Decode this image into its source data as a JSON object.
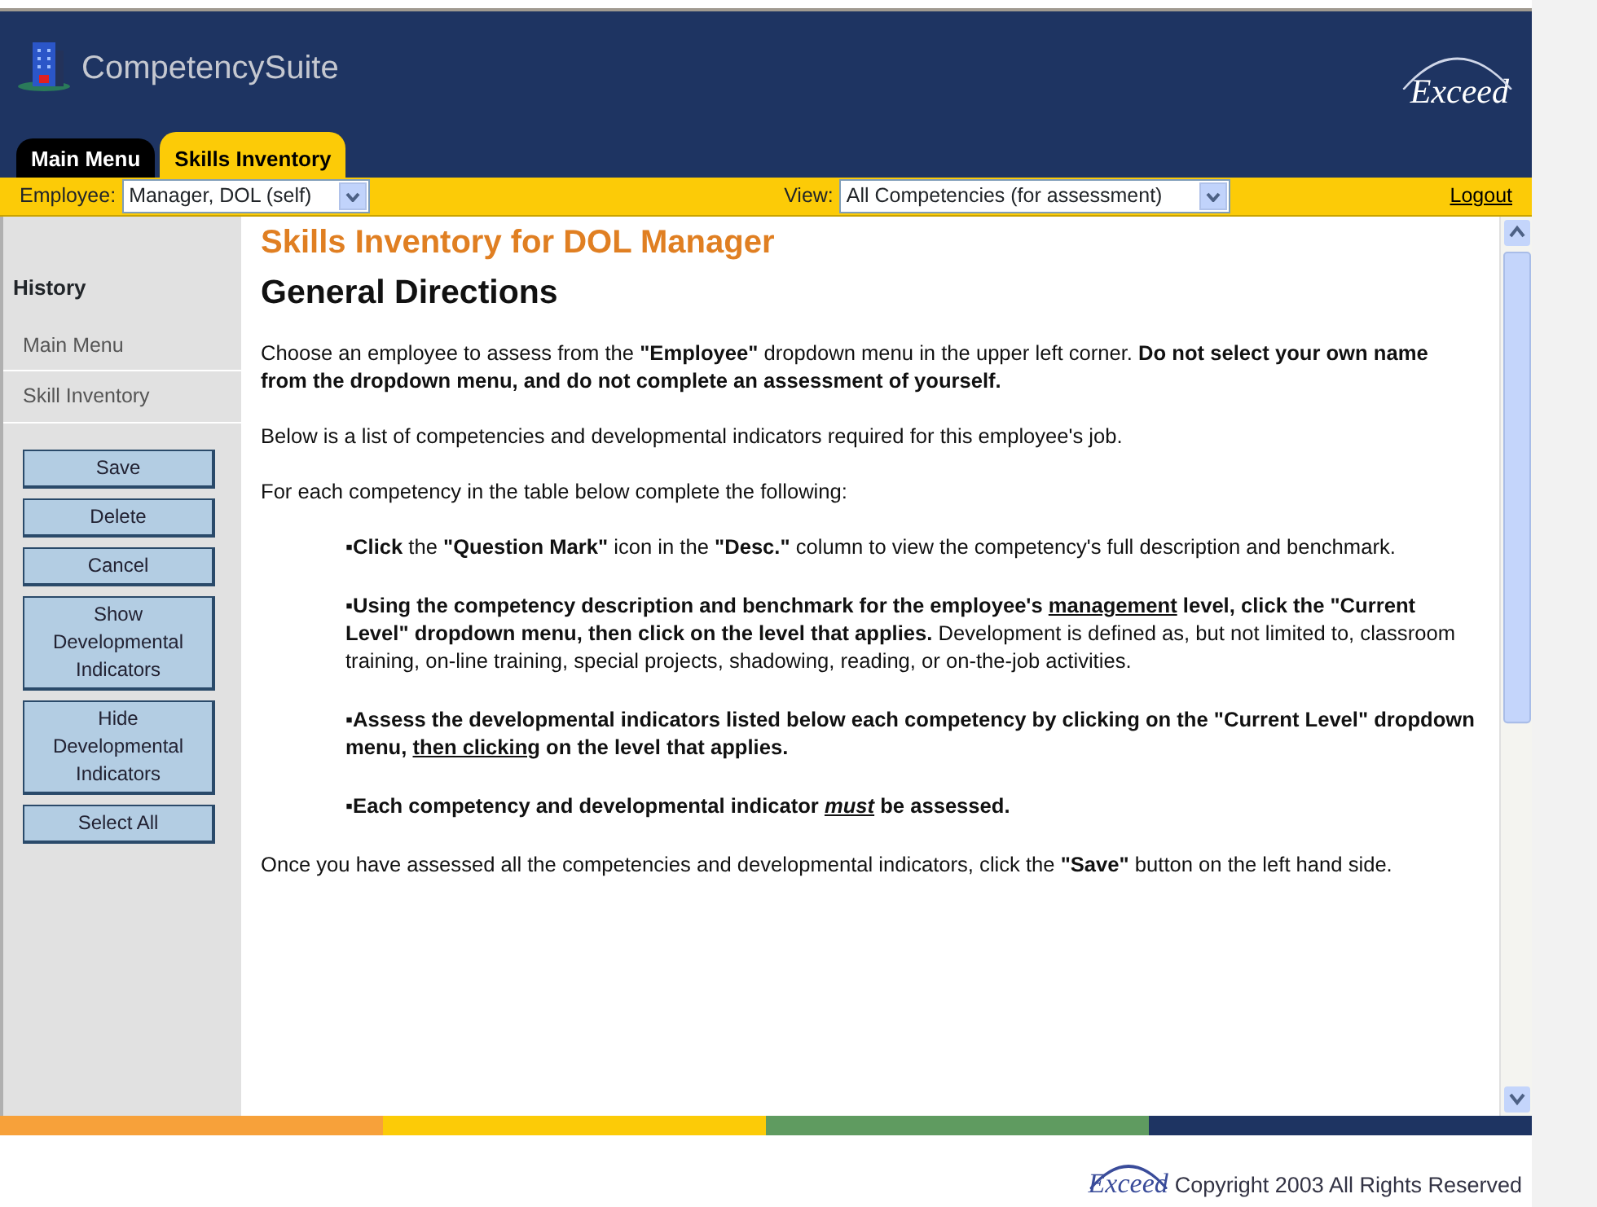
{
  "header": {
    "app_name": "CompetencySuite",
    "logo_text": "Exceed"
  },
  "tabs": [
    {
      "label": "Main Menu",
      "selected": false
    },
    {
      "label": "Skills Inventory",
      "selected": true
    }
  ],
  "toolbar": {
    "employee_label": "Employee:",
    "employee_value": "Manager, DOL (self)",
    "view_label": "View:",
    "view_value": "All Competencies (for assessment)",
    "logout": "Logout"
  },
  "sidebar": {
    "history_title": "History",
    "history_items": [
      "Main Menu",
      "Skill Inventory"
    ],
    "buttons": [
      "Save",
      "Delete",
      "Cancel",
      "Show Developmental Indicators",
      "Hide Developmental Indicators",
      "Select All"
    ]
  },
  "content": {
    "title": "Skills Inventory for DOL Manager",
    "heading": "General Directions",
    "paragraphs": [
      {
        "kind": "plain",
        "segments": [
          {
            "text": "Choose an employee to assess from the ",
            "kind": "plain"
          },
          {
            "text": "\"Employee\"",
            "kind": "bold"
          },
          {
            "text": " dropdown menu in the upper left corner. ",
            "kind": "plain"
          },
          {
            "text": "Do not select your own name from the dropdown menu, and do not complete an assessment of yourself.",
            "kind": "bold"
          }
        ]
      },
      {
        "kind": "plain",
        "segments": [
          {
            "text": "Below is a list of competencies and developmental indicators required for this employee's job.",
            "kind": "plain"
          }
        ]
      },
      {
        "kind": "plain",
        "segments": [
          {
            "text": "For each competency in the table below complete the following:",
            "kind": "plain"
          }
        ]
      },
      {
        "kind": "bullet",
        "segments": [
          {
            "text": "▪Click",
            "kind": "bold"
          },
          {
            "text": " the ",
            "kind": "plain"
          },
          {
            "text": "\"Question Mark\"",
            "kind": "bold"
          },
          {
            "text": " icon in the ",
            "kind": "plain"
          },
          {
            "text": "\"Desc.\"",
            "kind": "bold"
          },
          {
            "text": " column to view the competency's full description and benchmark.",
            "kind": "plain"
          }
        ]
      },
      {
        "kind": "bullet",
        "segments": [
          {
            "text": "▪Using the competency description and benchmark for the employee's ",
            "kind": "bold"
          },
          {
            "text": "management",
            "kind": "underlined"
          },
          {
            "text": " level, click the \"Current Level\" dropdown menu, then click on the level that applies.",
            "kind": "bold"
          },
          {
            "text": " Development is defined as, but not limited to, classroom training, on-line training, special projects, shadowing, reading, or on-the-job activities.",
            "kind": "plain"
          }
        ]
      },
      {
        "kind": "bullet",
        "segments": [
          {
            "text": "▪Assess the developmental indicators listed below each competency by clicking on the \"Current Level\" dropdown menu, ",
            "kind": "bold"
          },
          {
            "text": "then clicking",
            "kind": "underlined"
          },
          {
            "text": " on the level that applies.",
            "kind": "bold"
          }
        ]
      },
      {
        "kind": "bullet",
        "segments": [
          {
            "text": "▪Each competency and developmental indicator ",
            "kind": "bold"
          },
          {
            "text": "must",
            "kind": "underlined-italic"
          },
          {
            "text": " be assessed.",
            "kind": "bold"
          }
        ]
      },
      {
        "kind": "plain",
        "segments": [
          {
            "text": "Once you have assessed all the competencies and developmental indicators, click the ",
            "kind": "plain"
          },
          {
            "text": "\"Save\"",
            "kind": "bold"
          },
          {
            "text": " button on the left hand side.",
            "kind": "plain"
          }
        ]
      }
    ]
  },
  "footer": {
    "logo_text": "Exceed",
    "copyright": "Copyright 2003 All Rights Reserved"
  }
}
